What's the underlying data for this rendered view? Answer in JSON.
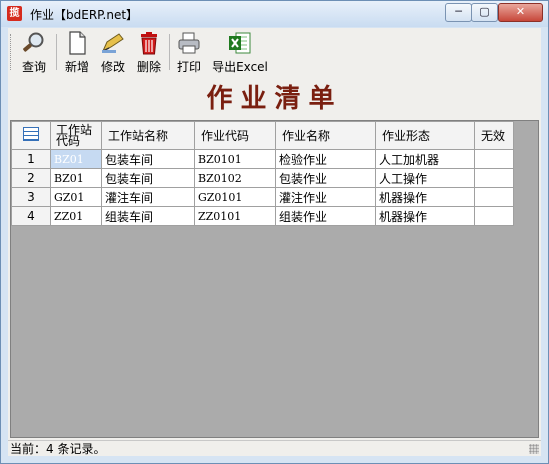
{
  "window": {
    "title": "作业【bdERP.net】",
    "controls": {
      "minimize": "─",
      "maximize": "▢",
      "close": "✕"
    }
  },
  "toolbar": {
    "query": "查询",
    "add": "新增",
    "edit": "修改",
    "delete": "删除",
    "print": "打印",
    "export": "导出Excel"
  },
  "form_title": "作业清单",
  "table": {
    "headers": [
      "工作站代码",
      "工作站名称",
      "作业代码",
      "作业名称",
      "作业形态",
      "无效"
    ],
    "header_code_line1": "工作站",
    "header_code_line2": "代码",
    "rows": [
      {
        "n": "1",
        "ws_code": "BZ01",
        "ws_name": "包装车间",
        "job_code": "BZ0101",
        "job_name": "检验作业",
        "form": "人工加机器",
        "invalid": ""
      },
      {
        "n": "2",
        "ws_code": "BZ01",
        "ws_name": "包装车间",
        "job_code": "BZ0102",
        "job_name": "包装作业",
        "form": "人工操作",
        "invalid": ""
      },
      {
        "n": "3",
        "ws_code": "GZ01",
        "ws_name": "灌注车间",
        "job_code": "GZ0101",
        "job_name": "灌注作业",
        "form": "机器操作",
        "invalid": ""
      },
      {
        "n": "4",
        "ws_code": "ZZ01",
        "ws_name": "组装车间",
        "job_code": "ZZ0101",
        "job_name": "组装作业",
        "form": "机器操作",
        "invalid": ""
      }
    ]
  },
  "status": "当前：4 条记录。"
}
